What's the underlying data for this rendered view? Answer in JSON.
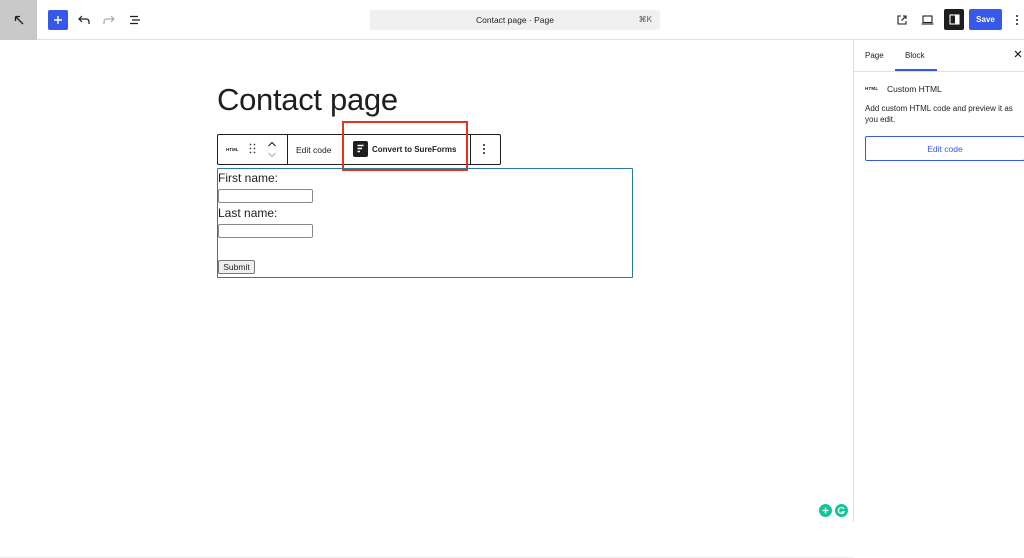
{
  "topbar": {
    "document_title": "Contact page · Page",
    "shortcut": "⌘K",
    "save_label": "Save"
  },
  "editor": {
    "page_title": "Contact page",
    "block_toolbar": {
      "block_type_label": "HTML",
      "edit_code_label": "Edit code",
      "convert_label": "Convert to SureForms"
    },
    "form": {
      "first_name_label": "First name:",
      "last_name_label": "Last name:",
      "submit_label": "Submit"
    }
  },
  "sidebar": {
    "tabs": [
      {
        "label": "Page",
        "active": false
      },
      {
        "label": "Block",
        "active": true
      }
    ],
    "block_badge": "HTML",
    "block_title": "Custom HTML",
    "block_description": "Add custom HTML code and preview it as you edit.",
    "edit_code_label": "Edit code"
  },
  "colors": {
    "accent": "#3858e9",
    "highlight": "#e8311e",
    "block_border": "#2a7a9a",
    "grammarly": "#15c39a"
  },
  "icons": [
    "arrow-up-left-icon",
    "plus-icon",
    "undo-icon",
    "redo-icon",
    "list-view-icon",
    "external-link-icon",
    "laptop-icon",
    "sidebar-icon",
    "more-vertical-icon",
    "close-icon",
    "drag-handle-icon",
    "chevron-up-icon",
    "chevron-down-icon",
    "sureforms-logo-icon",
    "grammarly-icon"
  ]
}
